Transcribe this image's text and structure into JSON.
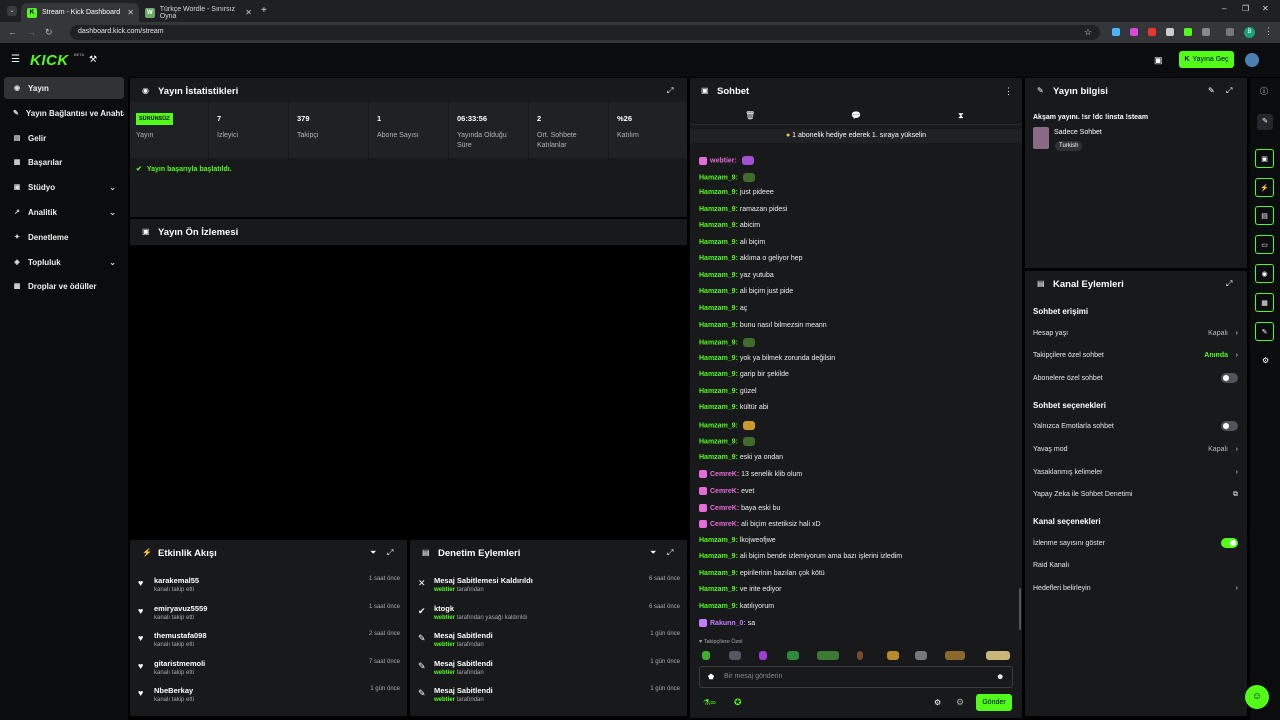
{
  "browser": {
    "tabs": [
      {
        "title": "Stream - Kick Dashboard"
      },
      {
        "title": "Türkçe Wordle - Sınırsız Oyna"
      }
    ],
    "url": "dashboard.kick.com/stream",
    "profile_initial": "B"
  },
  "header": {
    "logo": "KICK",
    "logo_badge": "BETA",
    "go_live": "Yayına Geç"
  },
  "sidebar": {
    "items": [
      {
        "label": "Yayın",
        "icon": "broadcast-icon"
      },
      {
        "label": "Yayın Bağlantısı ve Anahtarı",
        "icon": "key-icon"
      },
      {
        "label": "Gelir",
        "icon": "money-icon"
      },
      {
        "label": "Başarılar",
        "icon": "trophy-icon"
      },
      {
        "label": "Stüdyo",
        "icon": "studio-icon"
      },
      {
        "label": "Analitik",
        "icon": "analytics-icon"
      },
      {
        "label": "Denetleme",
        "icon": "wrench-icon"
      },
      {
        "label": "Topluluk",
        "icon": "community-icon"
      },
      {
        "label": "Droplar ve ödüller",
        "icon": "gift-icon"
      }
    ]
  },
  "stats": {
    "title": "Yayın İstatistikleri",
    "items": [
      {
        "value": "SÜRÜNSÜZ",
        "label": "Yayın"
      },
      {
        "value": "7",
        "label": "İzleyici"
      },
      {
        "value": "379",
        "label": "Takipçi"
      },
      {
        "value": "1",
        "label": "Abone Sayısı"
      },
      {
        "value": "06:33:56",
        "label": "Yayında Olduğu Süre"
      },
      {
        "value": "2",
        "label": "Ort. Sohbete Katılanlar"
      },
      {
        "value": "%26",
        "label": "Katılım"
      }
    ],
    "success": "Yayın başarıyla başlatıldı."
  },
  "preview": {
    "title": "Yayın Ön İzlemesi"
  },
  "activity": {
    "title": "Etkinlik Akışı",
    "items": [
      {
        "name": "karakemal55",
        "sub": "kanalı takip etti",
        "time": "1 saat önce"
      },
      {
        "name": "emiryavuz5559",
        "sub": "kanalı takip etti",
        "time": "1 saat önce"
      },
      {
        "name": "themustafa098",
        "sub": "kanalı takip etti",
        "time": "2 saat önce"
      },
      {
        "name": "gitaristmemoli",
        "sub": "kanalı takip etti",
        "time": "7 saat önce"
      },
      {
        "name": "NbeBerkay",
        "sub": "kanalı takip etti",
        "time": "1 gün önce"
      }
    ]
  },
  "moderation": {
    "title": "Denetim Eylemleri",
    "items": [
      {
        "name": "Mesaj Sabitlemesi Kaldırıldı",
        "user": "webtier",
        "sub": "tarafından",
        "time": "6 saat önce",
        "icon": "unpin-icon"
      },
      {
        "name": "ktogk",
        "user": "webtier",
        "sub": "tarafından yasağı kaldırıldı",
        "time": "6 saat önce",
        "icon": "unban-icon"
      },
      {
        "name": "Mesaj Sabitlendi",
        "user": "webtier",
        "sub": "tarafından",
        "time": "1 gün önce",
        "icon": "pin-icon"
      },
      {
        "name": "Mesaj Sabitlendi",
        "user": "webtier",
        "sub": "tarafından",
        "time": "1 gün önce",
        "icon": "pin-icon"
      },
      {
        "name": "Mesaj Sabitlendi",
        "user": "webtier",
        "sub": "tarafından",
        "time": "1 gün önce",
        "icon": "pin-icon"
      }
    ]
  },
  "chat": {
    "title": "Sohbet",
    "banner": "1 abonelik hediye ederek 1. sıraya yükselin",
    "messages": [
      {
        "user": "webtier:",
        "text": "",
        "color": "#e56bd8",
        "emote": "#a24fd1"
      },
      {
        "user": "Hamzam_9:",
        "text": "",
        "color": "#53fc18",
        "emote": "#3f6c2b"
      },
      {
        "user": "Hamzam_9:",
        "text": "just pideee",
        "color": "#53fc18"
      },
      {
        "user": "Hamzam_9:",
        "text": "ramazan pidesi",
        "color": "#53fc18"
      },
      {
        "user": "Hamzam_9:",
        "text": "abicim",
        "color": "#53fc18"
      },
      {
        "user": "Hamzam_9:",
        "text": "ali biçim",
        "color": "#53fc18"
      },
      {
        "user": "Hamzam_9:",
        "text": "aklıma o geliyor hep",
        "color": "#53fc18"
      },
      {
        "user": "Hamzam_9:",
        "text": "yaz yutuba",
        "color": "#53fc18"
      },
      {
        "user": "Hamzam_9:",
        "text": "ali biçim just pide",
        "color": "#53fc18"
      },
      {
        "user": "Hamzam_9:",
        "text": "aç",
        "color": "#53fc18"
      },
      {
        "user": "Hamzam_9:",
        "text": "bunu nasıl bilmezsin meann",
        "color": "#53fc18"
      },
      {
        "user": "Hamzam_9:",
        "text": "",
        "color": "#53fc18",
        "emote": "#3f6c2b"
      },
      {
        "user": "Hamzam_9:",
        "text": "yok ya bilmek zorunda değilsin",
        "color": "#53fc18"
      },
      {
        "user": "Hamzam_9:",
        "text": "garip bir şekilde",
        "color": "#53fc18"
      },
      {
        "user": "Hamzam_9:",
        "text": "güzel",
        "color": "#53fc18"
      },
      {
        "user": "Hamzam_9:",
        "text": "kültür abi",
        "color": "#53fc18"
      },
      {
        "user": "Hamzam_9:",
        "text": "",
        "color": "#53fc18",
        "emote": "#c99b2a"
      },
      {
        "user": "Hamzam_9:",
        "text": "",
        "color": "#53fc18",
        "emote": "#3f6c2b"
      },
      {
        "user": "Hamzam_9:",
        "text": "eski ya ondan",
        "color": "#53fc18"
      },
      {
        "user": "CemreK:",
        "text": "13 senelik klib olum",
        "color": "#e56bd8"
      },
      {
        "user": "CemreK:",
        "text": "evet",
        "color": "#e56bd8"
      },
      {
        "user": "CemreK:",
        "text": "baya eski bu",
        "color": "#e56bd8"
      },
      {
        "user": "CemreK:",
        "text": "ali biçim estetiksiz hali xD",
        "color": "#e56bd8"
      },
      {
        "user": "Hamzam_9:",
        "text": "lkojweofjwe",
        "color": "#53fc18"
      },
      {
        "user": "Hamzam_9:",
        "text": "ali biçim bende izlemiyorum ama bazı işlerini izledim",
        "color": "#53fc18"
      },
      {
        "user": "Hamzam_9:",
        "text": "epirilerinin bazıları çok kötü",
        "color": "#53fc18"
      },
      {
        "user": "Hamzam_9:",
        "text": "ve irite ediyor",
        "color": "#53fc18"
      },
      {
        "user": "Hamzam_9:",
        "text": "katılıyorum",
        "color": "#53fc18"
      },
      {
        "user": "Rakunn_0:",
        "text": "sa",
        "color": "#c57bff"
      }
    ],
    "followers_only": "Takipçilere Özel",
    "input_placeholder": "Bir mesaj gönderin",
    "send": "Gönder"
  },
  "stream_info": {
    "title": "Yayın bilgisi",
    "stream_title": "Akşam yayını. !sr !dc !insta !steam",
    "category": "Sadece Sohbet",
    "tag": "Turkish"
  },
  "channel_actions": {
    "title": "Kanal Eylemleri",
    "chat_access": "Sohbet erişimi",
    "account_age": {
      "label": "Hesap yaşı",
      "value": "Kapalı"
    },
    "followers_chat": {
      "label": "Takipçilere özel sohbet",
      "value": "Anında"
    },
    "subscribers_chat": {
      "label": "Abonelere özel sohbet",
      "enabled": false
    },
    "chat_options": "Sohbet seçenekleri",
    "emote_only": {
      "label": "Yalnızca Emotlarla sohbet",
      "enabled": false
    },
    "slow_mode": {
      "label": "Yavaş mod",
      "value": "Kapalı"
    },
    "banned_words": {
      "label": "Yasaklanmış kelimeler"
    },
    "ai_moderation": {
      "label": "Yapay Zeka ile Sohbet Denetimi"
    },
    "channel_options": "Kanal seçenekleri",
    "show_viewers": {
      "label": "İzlenme sayısını göster",
      "enabled": true
    },
    "raid": {
      "label": "Raid Kanalı"
    },
    "targets": {
      "label": "Hedefleri belirleyin"
    }
  },
  "colors": {
    "accent": "#53fc18",
    "panel": "#18191b",
    "background": "#000000"
  }
}
